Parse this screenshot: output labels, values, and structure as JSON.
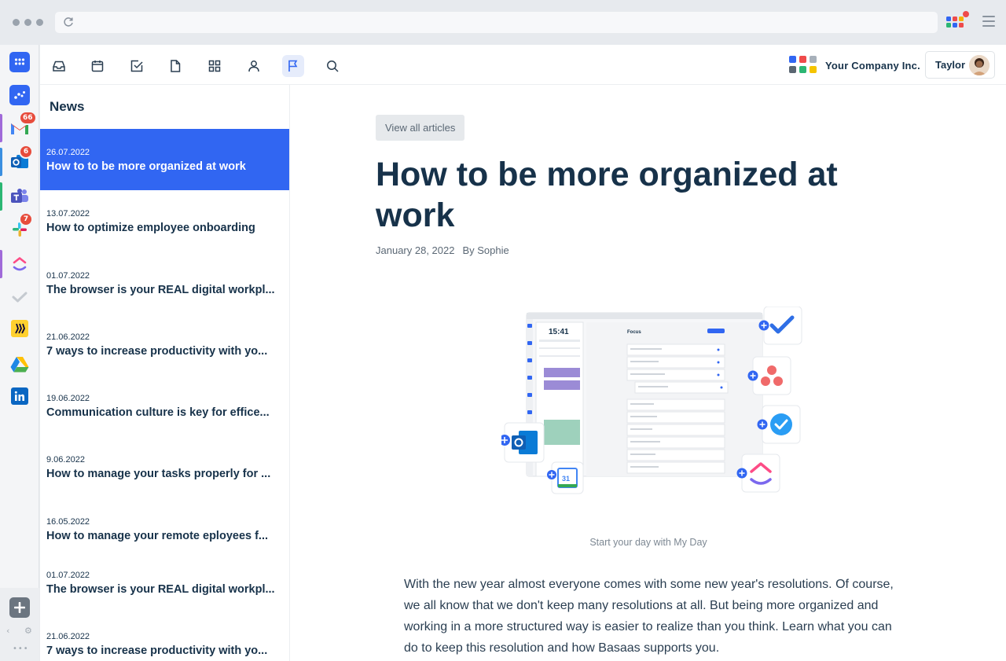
{
  "browser": {
    "menu_icon": "hamburger-icon",
    "reload_icon": "reload-icon"
  },
  "dock": {
    "apps": [
      {
        "name": "apps-grid",
        "badge": ""
      },
      {
        "name": "basaas",
        "badge": ""
      },
      {
        "name": "gmail",
        "badge": "66"
      },
      {
        "name": "outlook",
        "badge": "6"
      },
      {
        "name": "teams",
        "badge": ""
      },
      {
        "name": "slack",
        "badge": "7"
      },
      {
        "name": "clickup",
        "badge": ""
      },
      {
        "name": "tasks",
        "badge": ""
      },
      {
        "name": "miro",
        "badge": ""
      },
      {
        "name": "google-drive",
        "badge": ""
      },
      {
        "name": "linkedin",
        "badge": ""
      }
    ]
  },
  "toolbar": {
    "icons": [
      "inbox-icon",
      "calendar-icon",
      "task-check-icon",
      "document-icon",
      "dashboard-grid-icon",
      "person-icon",
      "flag-icon",
      "search-icon"
    ]
  },
  "header": {
    "company_name": "Your Company Inc.",
    "user_name": "Taylor"
  },
  "news": {
    "title": "News",
    "items": [
      {
        "date": "26.07.2022",
        "title": "How to to be more organized at work",
        "active": true
      },
      {
        "date": "13.07.2022",
        "title": "How to optimize employee onboarding"
      },
      {
        "date": "01.07.2022",
        "title": "The browser is your REAL digital workpl..."
      },
      {
        "date": "21.06.2022",
        "title": "7 ways to increase productivity with yo..."
      },
      {
        "date": "19.06.2022",
        "title": "Communication culture is key for effice..."
      },
      {
        "date": "9.06.2022",
        "title": "How to manage your tasks properly for ..."
      },
      {
        "date": "16.05.2022",
        "title": "How to manage your remote eployees f..."
      },
      {
        "date": "01.07.2022",
        "title": "The browser is your REAL digital workpl..."
      },
      {
        "date": "21.06.2022",
        "title": "7 ways to increase productivity with yo..."
      }
    ]
  },
  "article": {
    "view_all_label": "View all articles",
    "title": "How to be more organized at work",
    "date": "January 28, 2022",
    "author": "By Sophie",
    "illustration_time": "15:41",
    "illustration_panel": "Focus",
    "caption": "Start your day with My Day",
    "body": "With the new year almost everyone comes with some new year's resolutions. Of course, we all know that we don't keep many resolutions at all. But being more organized and working in a more structured way is easier to realize than you think. Learn what you can do to keep this resolution and how Basaas supports you."
  },
  "colors": {
    "accent": "#3166f2",
    "heading": "#17324a",
    "badge": "#e74c3c"
  }
}
